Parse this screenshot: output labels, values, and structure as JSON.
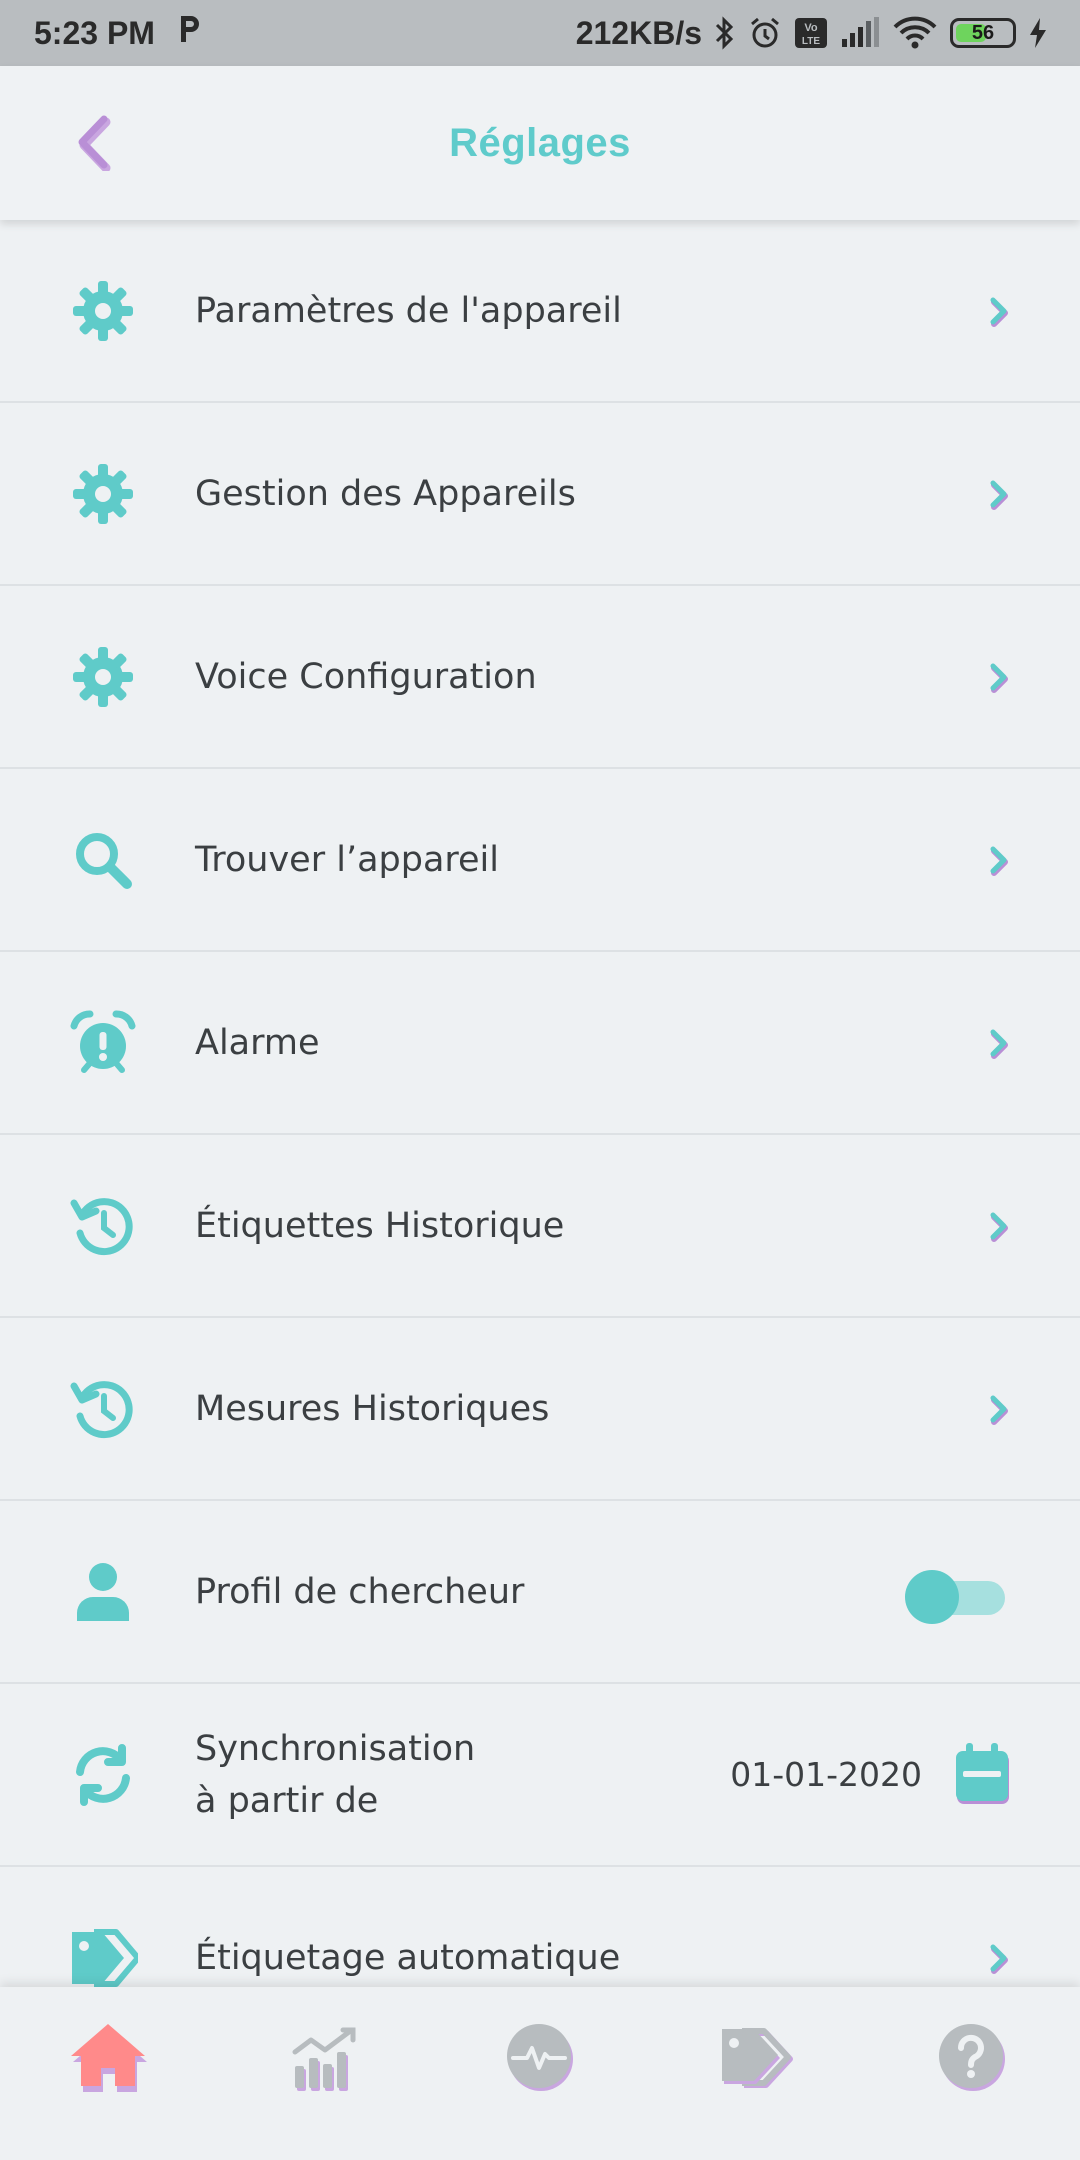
{
  "status_bar": {
    "time": "5:23 PM",
    "network_speed": "212KB/s",
    "battery_level": 56,
    "battery_text": "56",
    "icons": [
      "p-icon",
      "bluetooth-icon",
      "alarm-icon",
      "volte-icon",
      "signal-icon",
      "wifi-icon",
      "battery-icon",
      "charging-icon"
    ]
  },
  "header": {
    "title": "Réglages",
    "back_icon": "chevron-left-icon"
  },
  "colors": {
    "accent_teal": "#5fcbcb",
    "accent_purple": "#b98fd6",
    "home_active": "#ff8a8a",
    "nav_inactive": "#b7bcbf"
  },
  "settings": {
    "items": [
      {
        "label": "Paramètres de l'appareil",
        "icon": "gear-icon"
      },
      {
        "label": "Gestion des Appareils",
        "icon": "gear-icon"
      },
      {
        "label": "Voice Configuration",
        "icon": "gear-icon"
      },
      {
        "label": "Trouver l’appareil",
        "icon": "search-icon"
      },
      {
        "label": "Alarme",
        "icon": "alarm-clock-icon"
      },
      {
        "label": "Étiquettes Historique",
        "icon": "history-icon"
      },
      {
        "label": "Mesures Historiques",
        "icon": "history-icon"
      }
    ],
    "researcher_profile": {
      "label": "Profil de chercheur",
      "icon": "user-icon",
      "enabled": true
    },
    "sync": {
      "line1": "Synchronisation",
      "line2": "à partir de",
      "date": "01-01-2020",
      "icon": "sync-icon",
      "calendar_icon": "calendar-icon"
    },
    "auto_tagging": {
      "label": "Étiquetage automatique",
      "icon": "tag-icon"
    }
  },
  "bottom_nav": {
    "items": [
      {
        "name": "home",
        "icon": "home-icon",
        "active": true
      },
      {
        "name": "stats",
        "icon": "chart-icon",
        "active": false
      },
      {
        "name": "measure",
        "icon": "heartbeat-icon",
        "active": false
      },
      {
        "name": "tags",
        "icon": "tags-icon",
        "active": false
      },
      {
        "name": "help",
        "icon": "help-icon",
        "active": false
      }
    ]
  }
}
